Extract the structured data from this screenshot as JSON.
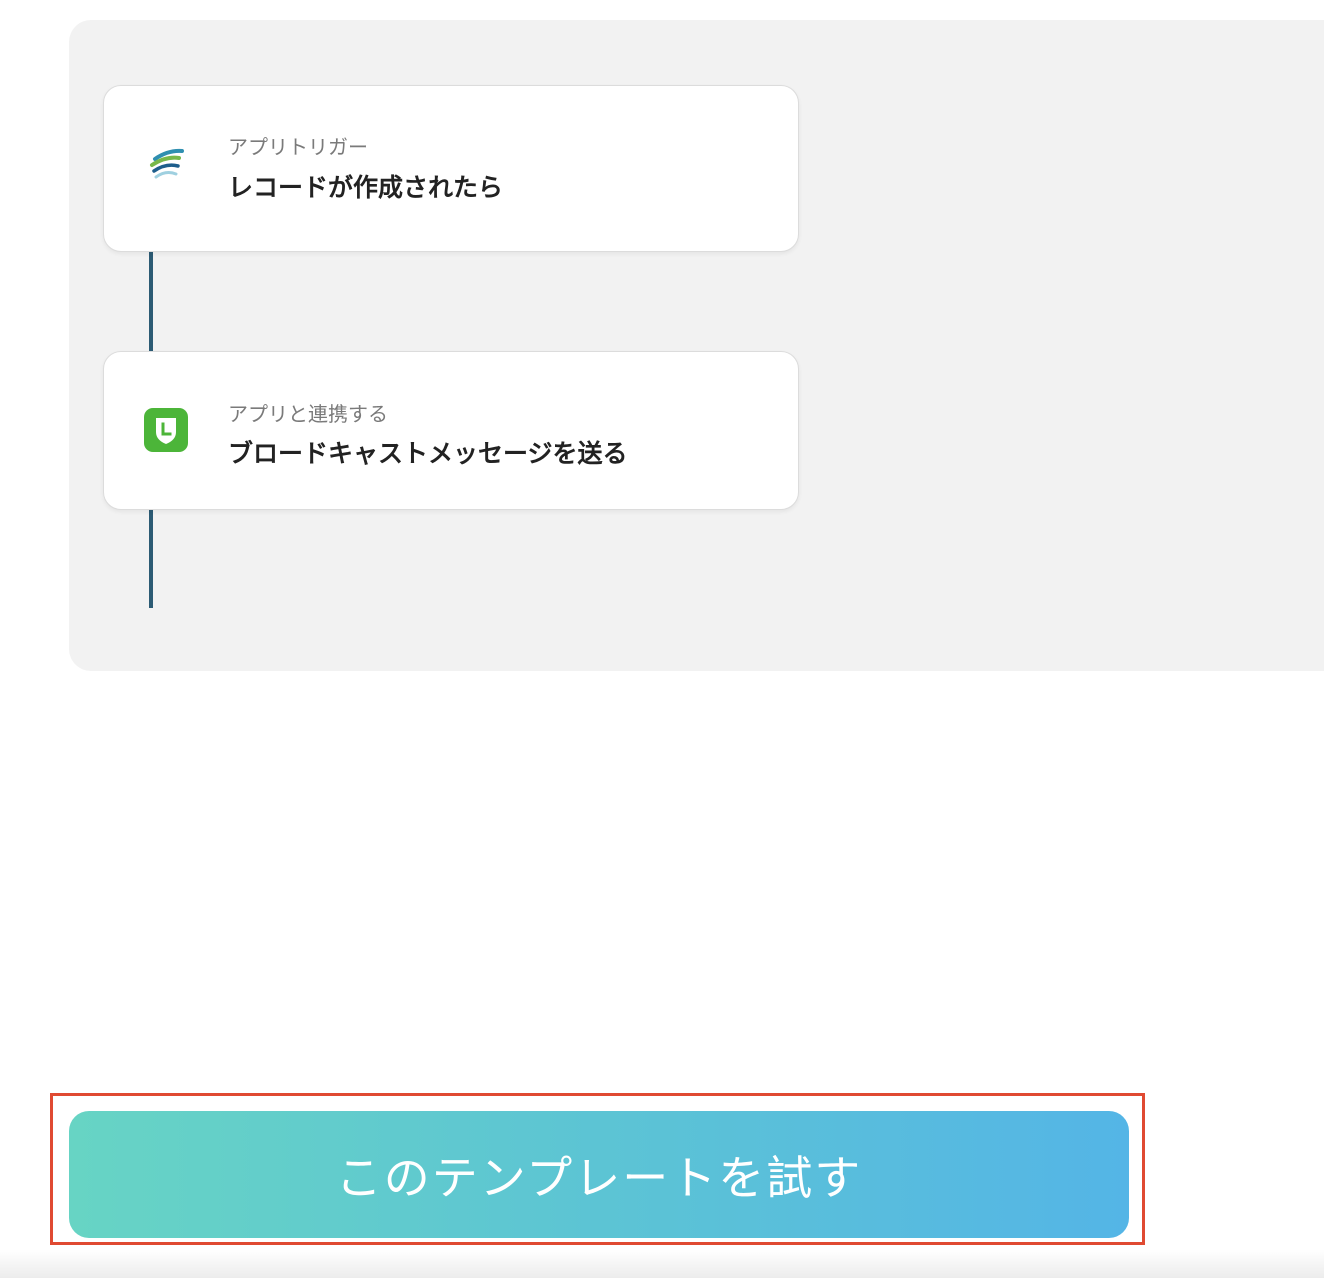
{
  "flow": {
    "steps": [
      {
        "icon": "kintone-icon",
        "label": "アプリトリガー",
        "title": "レコードが作成されたら"
      },
      {
        "icon": "line-official-account-icon",
        "label": "アプリと連携する",
        "title": "ブロードキャストメッセージを送る"
      }
    ]
  },
  "cta": {
    "label": "このテンプレートを試す"
  },
  "colors": {
    "panel_background": "#f2f2f2",
    "connector": "#2c5b74",
    "highlight_border": "#e04a32",
    "button_gradient_start": "#67d4c4",
    "button_gradient_end": "#54b5e6",
    "line_green": "#4cb539"
  }
}
